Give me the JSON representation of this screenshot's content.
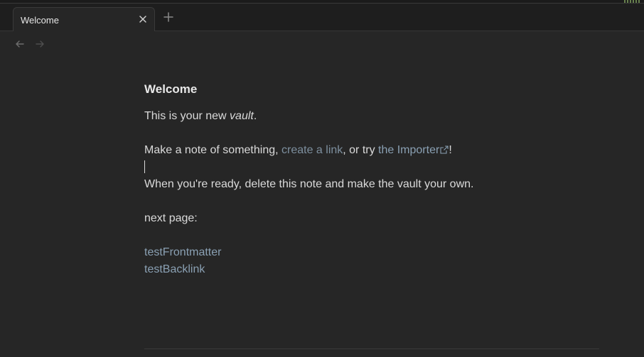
{
  "tab": {
    "title": "Welcome"
  },
  "note": {
    "title": "Welcome",
    "intro_prefix": "This is your new ",
    "intro_emph": "vault",
    "intro_suffix": ".",
    "make_prefix": "Make a note of something, ",
    "make_link": "create a link",
    "make_middle": ", or try ",
    "make_link2": "the Importer",
    "make_suffix": "!",
    "ready": "When you're ready, delete this note and make the vault your own.",
    "next_label": "next page:",
    "links": [
      "testFrontmatter",
      "testBacklink"
    ]
  },
  "icons": {
    "tab_close": "close-icon",
    "new_tab": "plus-icon",
    "back": "arrow-left-icon",
    "forward": "arrow-right-icon",
    "external": "external-link-icon"
  },
  "colors": {
    "background": "#262626",
    "tabbar": "#1e1e1e",
    "text": "#dadada",
    "link": "#8aa0b3"
  }
}
